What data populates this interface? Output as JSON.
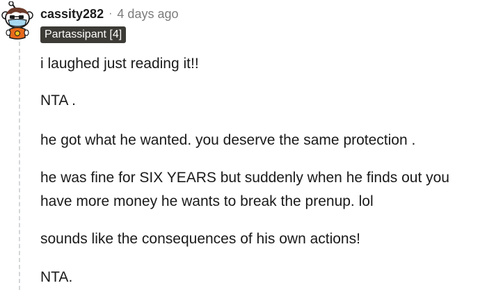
{
  "comment": {
    "author": "cassity282",
    "separator": "·",
    "time": "4 days ago",
    "flair": "Partassipant [4]",
    "paragraphs": [
      "i laughed just reading it!!",
      "NTA .",
      "he got what he wanted. you deserve the same protection .",
      "he was fine for SIX YEARS but suddenly when he finds out you",
      "have more money he wants to break the prenup. lol",
      "sounds like the consequences of his own actions!",
      "NTA."
    ]
  },
  "colors": {
    "flair_bg": "#3d3b36",
    "username": "#1c1c1c",
    "meta_gray": "#7c7c7c",
    "body_text": "#1a1a1b",
    "thread_line": "#d4d6d8"
  },
  "icons": {
    "avatar": "snoo-avatar-icon"
  }
}
